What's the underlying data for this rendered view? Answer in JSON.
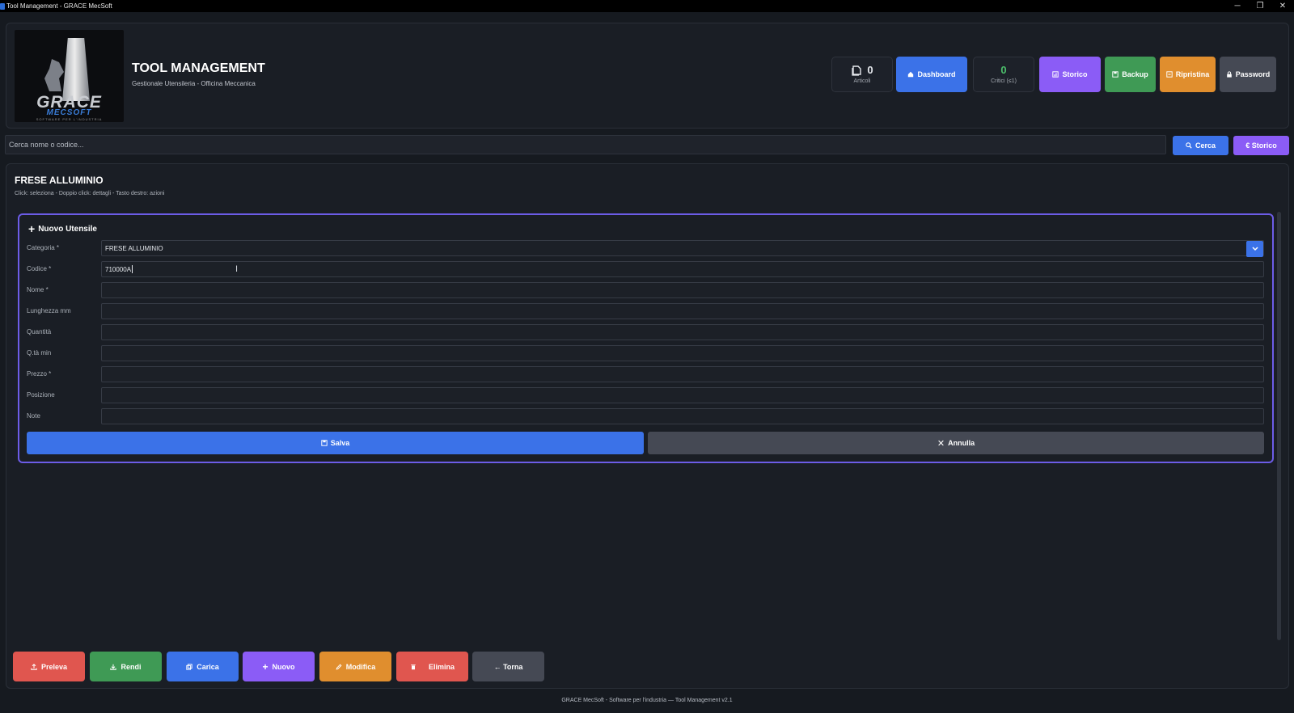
{
  "window": {
    "title": "Tool Management - GRACE MecSoft",
    "controls": [
      "─",
      "❐",
      "✕"
    ]
  },
  "header": {
    "logo": {
      "name": "GRACE",
      "sub": "MECSOFT",
      "tagline": "SOFTWARE PER L'INDUSTRIA"
    },
    "title": "TOOL MANAGEMENT",
    "subtitle": "Gestionale Utensileria - Officina Meccanica",
    "stats": {
      "articoli": {
        "value": "0",
        "label": "Articoli"
      },
      "critici": {
        "value": "0",
        "label": "Critici (≤1)"
      }
    },
    "buttons": {
      "dashboard": "Dashboard",
      "storico": "Storico",
      "backup": "Backup",
      "ripristina": "Ripristina",
      "password": "Password"
    }
  },
  "search": {
    "placeholder": "Cerca nome o codice...",
    "cerca_label": "Cerca",
    "storico_label": "€ Storico"
  },
  "category": {
    "title": "FRESE ALLUMINIO",
    "hint": "Click: seleziona - Doppio click: dettagli - Tasto destro: azioni"
  },
  "form": {
    "title": "Nuovo Utensile",
    "fields": [
      {
        "label": "Categoria *",
        "value": "FRESE ALLUMINIO"
      },
      {
        "label": "Codice *",
        "value": "710000A"
      },
      {
        "label": "Nome *",
        "value": ""
      },
      {
        "label": "Lunghezza mm",
        "value": ""
      },
      {
        "label": "Quantità",
        "value": ""
      },
      {
        "label": "Q.tà min",
        "value": ""
      },
      {
        "label": "Prezzo  *",
        "value": ""
      },
      {
        "label": "Posizione",
        "value": ""
      },
      {
        "label": "Note",
        "value": ""
      }
    ],
    "save_label": "Salva",
    "cancel_label": "Annulla"
  },
  "actions": {
    "preleva": "Preleva",
    "rendi": "Rendi",
    "carica": "Carica",
    "nuovo": "Nuovo",
    "modifica": "Modifica",
    "elimina": "Elimina",
    "torna": "← Torna"
  },
  "footer": "GRACE MecSoft - Software per l'industria — Tool Management v2.1",
  "colors": {
    "blue": "#3b72e8",
    "purple": "#8b5cf6",
    "green": "#3f9a55",
    "orange": "#e08e2e",
    "red": "#e0564f",
    "gray": "#454954",
    "form_border": "#6c5ce7",
    "critici_green": "#4cbf6b"
  }
}
